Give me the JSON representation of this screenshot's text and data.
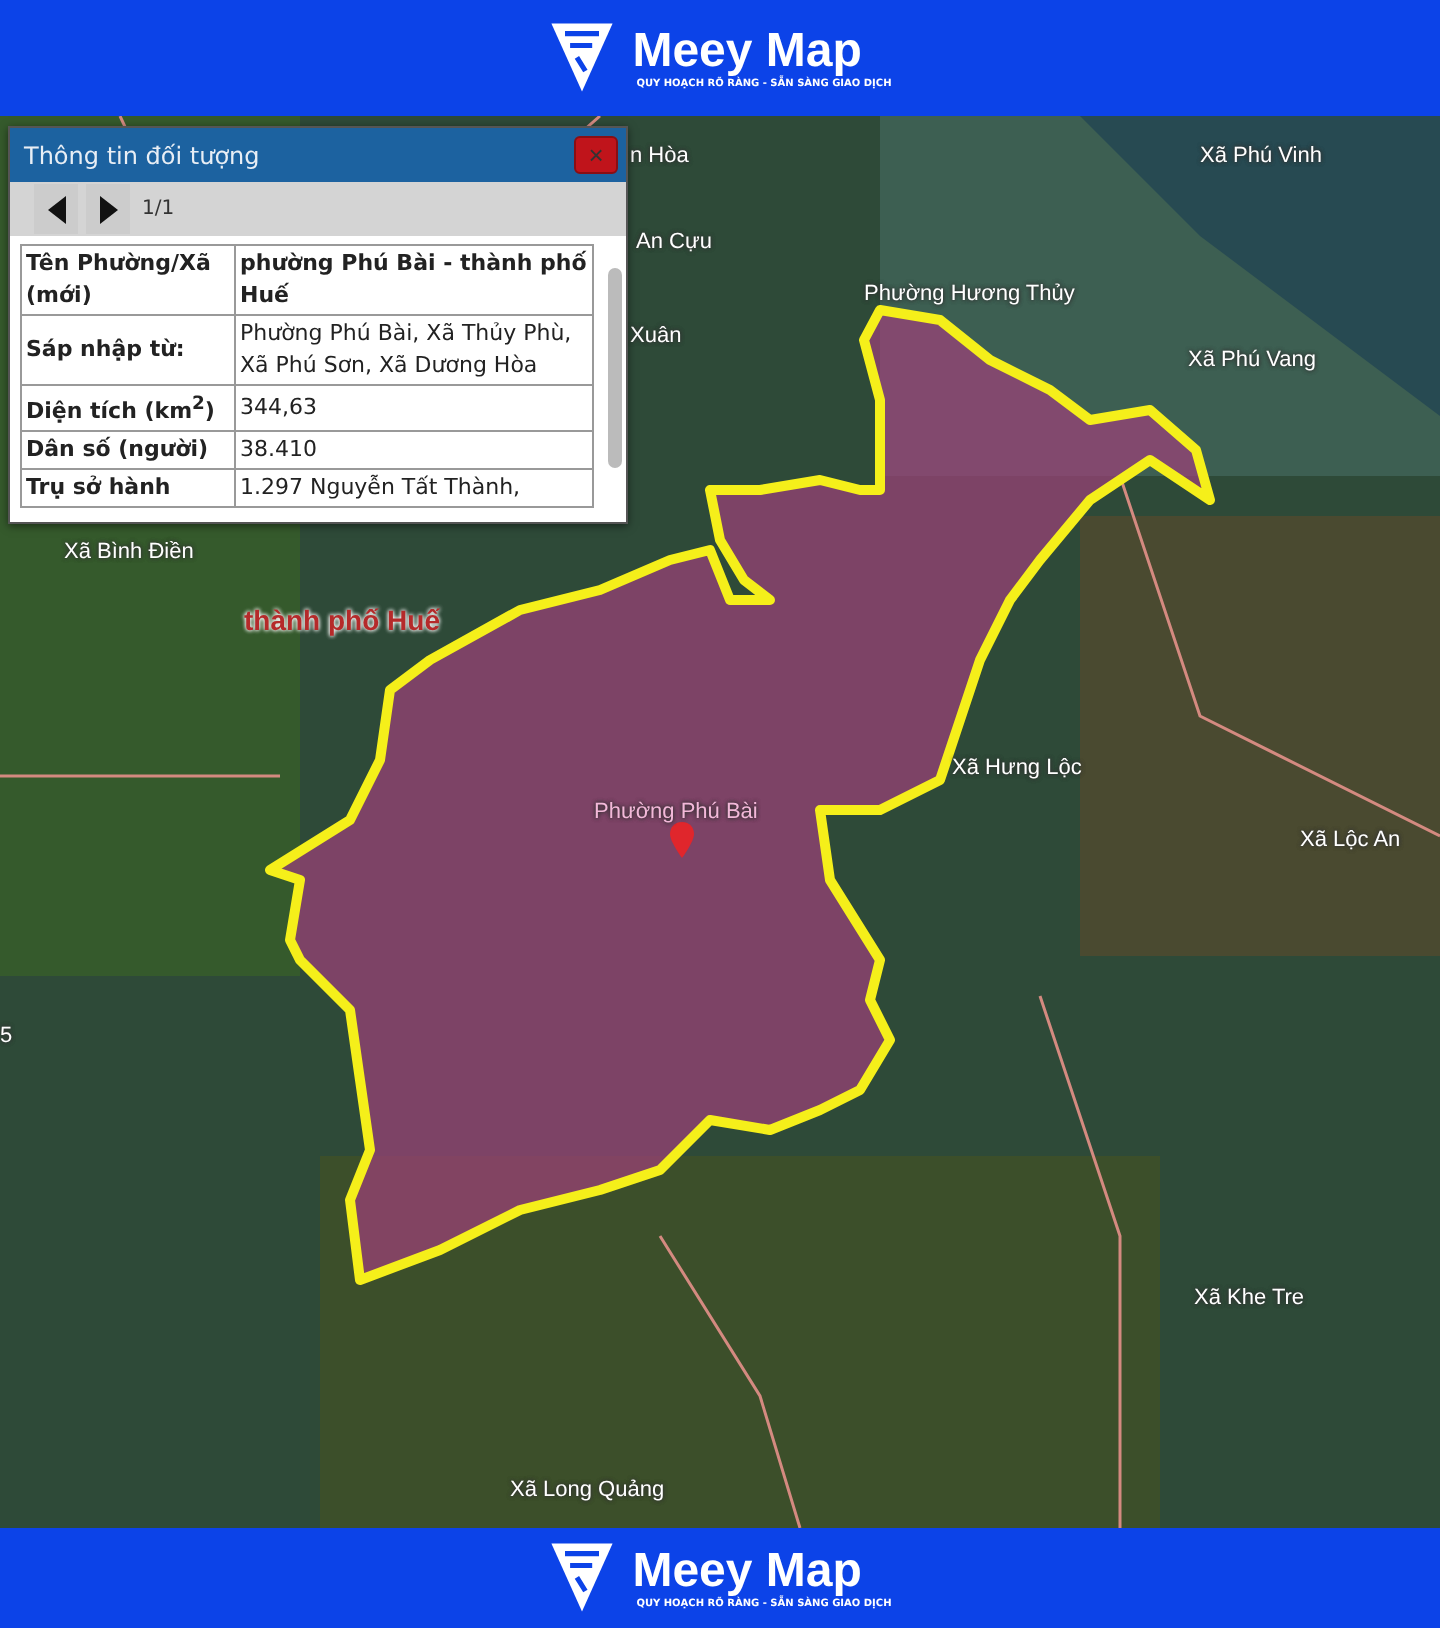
{
  "header": {
    "brand": "Meey Map",
    "tagline": "QUY HOẠCH RÕ RÀNG - SẴN SÀNG GIAO DỊCH"
  },
  "panel": {
    "title": "Thông tin đối tượng",
    "close": "×",
    "pager": "1/1",
    "rows": [
      {
        "label": "Tên Phường/Xã (mới)",
        "value": "phường Phú Bài - thành phố Huế",
        "bold_value": true
      },
      {
        "label": "Sáp nhập từ:",
        "value": "Phường Phú Bài, Xã Thủy Phù, Xã Phú Sơn, Xã Dương Hòa",
        "bold_value": false
      },
      {
        "label": "Diện tích (km$^{2}$)",
        "value": "344,63",
        "bold_value": false
      },
      {
        "label": "Dân số (người)",
        "value": "38.410",
        "bold_value": false
      },
      {
        "label": "Trụ sở hành",
        "value": "1.297 Nguyễn Tất Thành,",
        "bold_value": false
      }
    ]
  },
  "map": {
    "labels": [
      {
        "text": "n Hòa",
        "kind": "place"
      },
      {
        "text": "Xã Phú Vinh",
        "kind": "place"
      },
      {
        "text": "An Cựu",
        "kind": "place"
      },
      {
        "text": "Phường Hương Thủy",
        "kind": "place"
      },
      {
        "text": "Xuân",
        "kind": "place"
      },
      {
        "text": "Xã Phú Vang",
        "kind": "place"
      },
      {
        "text": "Xã Bình Điền",
        "kind": "place"
      },
      {
        "text": "thành phố Huế",
        "kind": "city"
      },
      {
        "text": "Xã Hưng Lộc",
        "kind": "place"
      },
      {
        "text": "Phường Phú Bài",
        "kind": "selected"
      },
      {
        "text": "Xã Lộc An",
        "kind": "place"
      },
      {
        "text": "5",
        "kind": "place"
      },
      {
        "text": "Xã Khe Tre",
        "kind": "place"
      },
      {
        "text": "Xã Long Quảng",
        "kind": "place"
      }
    ]
  },
  "footer": {
    "brand": "Meey Map",
    "tagline": "QUY HOẠCH RÕ RÀNG - SẴN SÀNG GIAO DỊCH"
  }
}
